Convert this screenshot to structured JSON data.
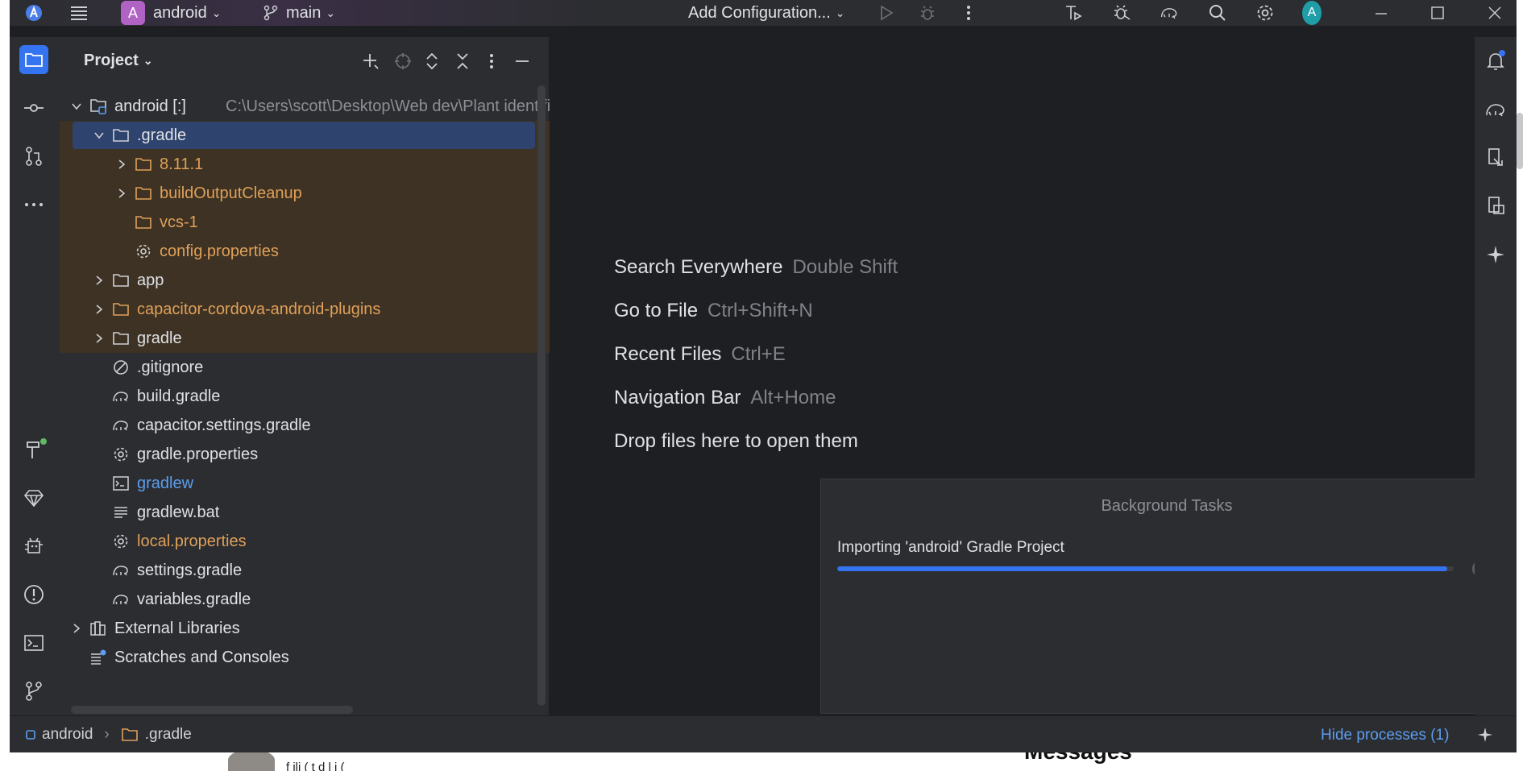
{
  "titlebar": {
    "project_badge": "A",
    "project_name": "android",
    "branch": "main",
    "run_config": "Add Configuration...",
    "avatar_letter": "A"
  },
  "project_panel": {
    "title": "Project",
    "tree": [
      {
        "label": "android [:]",
        "path": "C:\\Users\\scott\\Desktop\\Web dev\\Plant identifie",
        "indent": 0,
        "chevron": "down",
        "icon": "module-icon",
        "color": "white"
      },
      {
        "label": ".gradle",
        "indent": 1,
        "chevron": "down",
        "icon": "folder-icon",
        "color": "white",
        "selected": true,
        "excluded": true
      },
      {
        "label": "8.11.1",
        "indent": 2,
        "chevron": "right",
        "icon": "folder-icon",
        "color": "orange",
        "excluded": true
      },
      {
        "label": "buildOutputCleanup",
        "indent": 2,
        "chevron": "right",
        "icon": "folder-icon",
        "color": "orange",
        "excluded": true
      },
      {
        "label": "vcs-1",
        "indent": 2,
        "chevron": "",
        "icon": "folder-icon",
        "color": "orange",
        "excluded": true
      },
      {
        "label": "config.properties",
        "indent": 2,
        "chevron": "",
        "icon": "gear-icon",
        "color": "orange",
        "excluded": true
      },
      {
        "label": "app",
        "indent": 1,
        "chevron": "right",
        "icon": "folder-icon",
        "color": "white",
        "excluded": true
      },
      {
        "label": "capacitor-cordova-android-plugins",
        "indent": 1,
        "chevron": "right",
        "icon": "folder-icon",
        "color": "orange",
        "excluded": true
      },
      {
        "label": "gradle",
        "indent": 1,
        "chevron": "right",
        "icon": "folder-icon",
        "color": "white",
        "excluded": true
      },
      {
        "label": ".gitignore",
        "indent": 1,
        "chevron": "",
        "icon": "ignore-icon",
        "color": "white"
      },
      {
        "label": "build.gradle",
        "indent": 1,
        "chevron": "",
        "icon": "gradle-icon",
        "color": "white"
      },
      {
        "label": "capacitor.settings.gradle",
        "indent": 1,
        "chevron": "",
        "icon": "gradle-icon",
        "color": "white"
      },
      {
        "label": "gradle.properties",
        "indent": 1,
        "chevron": "",
        "icon": "gear-icon",
        "color": "white"
      },
      {
        "label": "gradlew",
        "indent": 1,
        "chevron": "",
        "icon": "terminal-file-icon",
        "color": "blue"
      },
      {
        "label": "gradlew.bat",
        "indent": 1,
        "chevron": "",
        "icon": "text-file-icon",
        "color": "white"
      },
      {
        "label": "local.properties",
        "indent": 1,
        "chevron": "",
        "icon": "gear-icon",
        "color": "orange"
      },
      {
        "label": "settings.gradle",
        "indent": 1,
        "chevron": "",
        "icon": "gradle-icon",
        "color": "white"
      },
      {
        "label": "variables.gradle",
        "indent": 1,
        "chevron": "",
        "icon": "gradle-icon",
        "color": "white"
      },
      {
        "label": "External Libraries",
        "indent": 0,
        "chevron": "right",
        "icon": "library-icon",
        "color": "white"
      },
      {
        "label": "Scratches and Consoles",
        "indent": 0,
        "chevron": "",
        "icon": "scratches-icon",
        "color": "white"
      }
    ]
  },
  "editor": {
    "hints": [
      {
        "action": "Search Everywhere",
        "shortcut": "Double Shift"
      },
      {
        "action": "Go to File",
        "shortcut": "Ctrl+Shift+N"
      },
      {
        "action": "Recent Files",
        "shortcut": "Ctrl+E"
      },
      {
        "action": "Navigation Bar",
        "shortcut": "Alt+Home"
      },
      {
        "action": "Drop files here to open them",
        "shortcut": ""
      }
    ]
  },
  "background_tasks": {
    "title": "Background Tasks",
    "task": "Importing 'android' Gradle Project",
    "progress": 0.99
  },
  "statusbar": {
    "crumb_project": "android",
    "crumb_folder": ".gradle",
    "hide_processes": "Hide processes (1)"
  },
  "behind_window": {
    "text": "f ili  ( t   d l  i  (",
    "messages": "Messages"
  },
  "colors": {
    "accent": "#3574f0",
    "excluded_bg": "#3d3223",
    "orange_text": "#e0a05a",
    "link_blue": "#5c9ef0"
  }
}
